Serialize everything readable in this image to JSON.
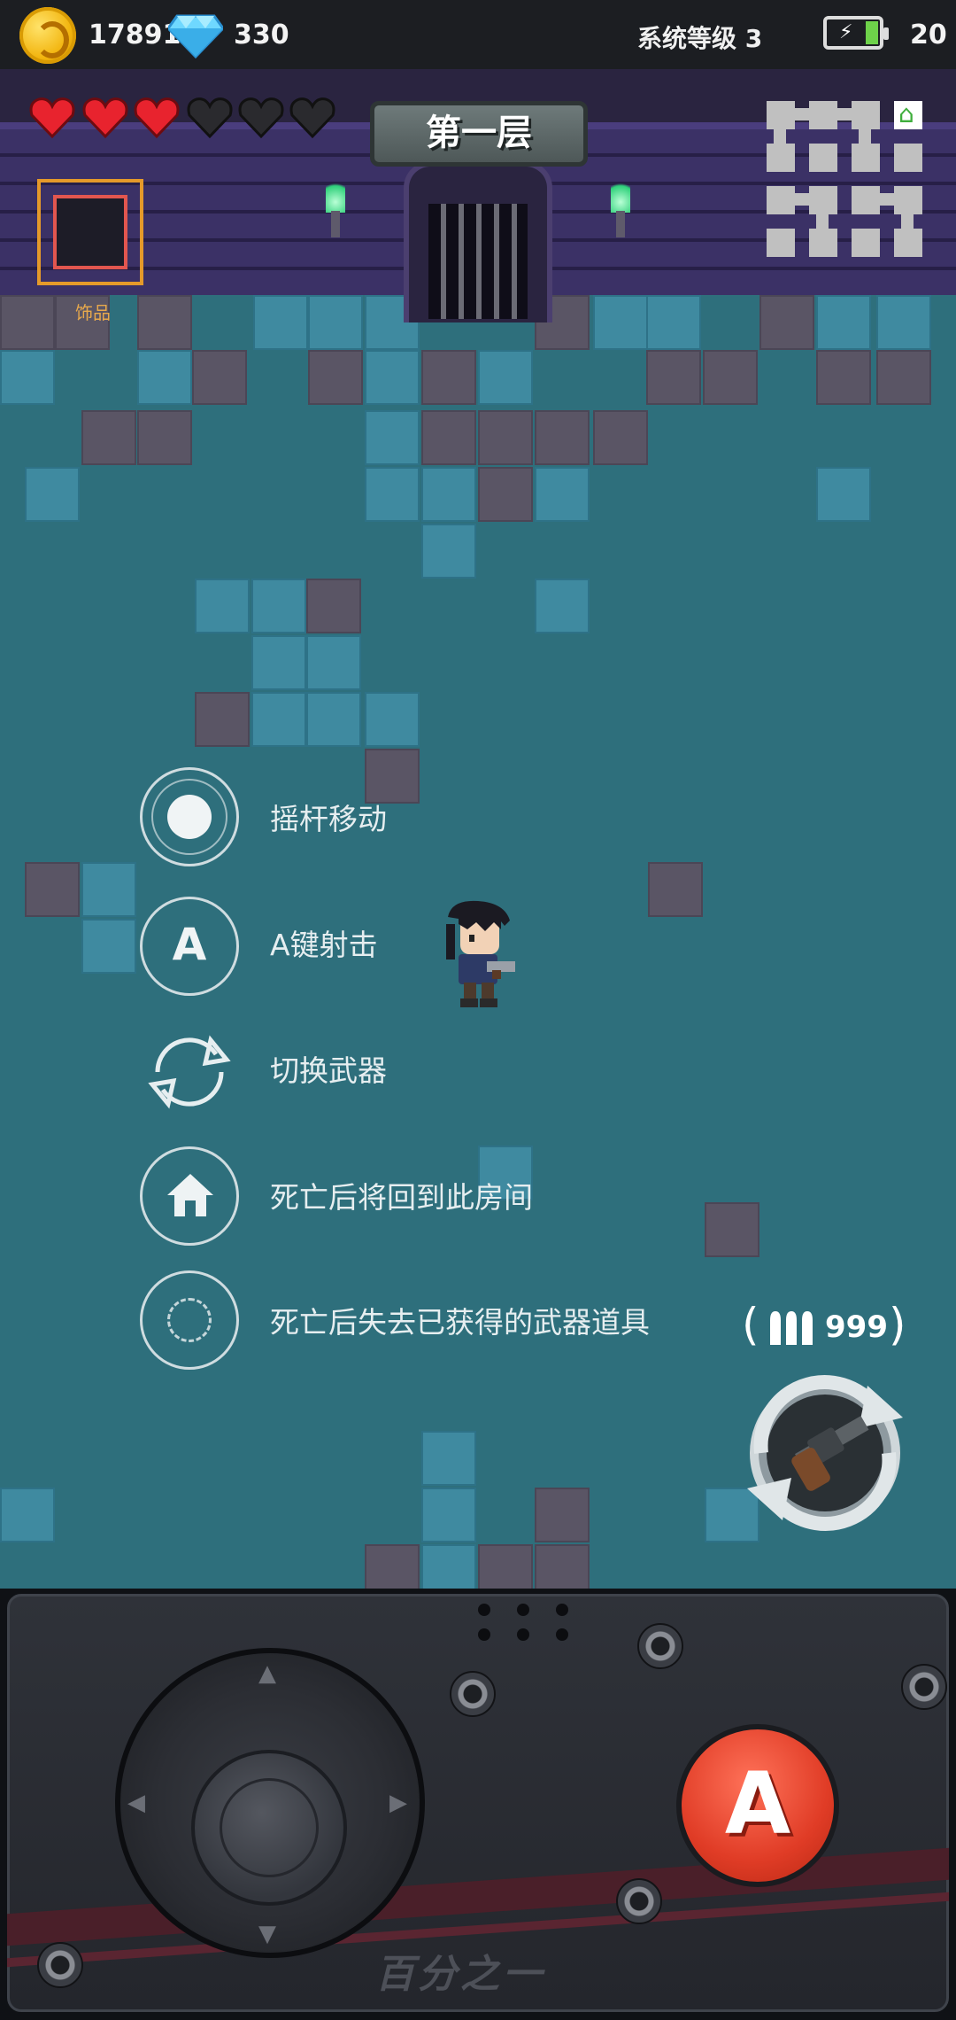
{
  "status_bar": {
    "coins": "17891",
    "gems": "330",
    "system_level": "系统等级 3",
    "energy": "20"
  },
  "hud": {
    "hearts_full": 3,
    "hearts_total": 6,
    "floor_title": "第一层",
    "accessory_label": "饰品"
  },
  "tutorial": {
    "items": [
      {
        "label": "摇杆移动",
        "icon": "joystick-icon"
      },
      {
        "label": "A键射击",
        "icon": "a-button-icon"
      },
      {
        "label": "切换武器",
        "icon": "switch-icon"
      },
      {
        "label": "死亡后将回到此房间",
        "icon": "home-icon"
      },
      {
        "label": "死亡后失去已获得的武器道具",
        "icon": "dashed-circle-icon"
      }
    ]
  },
  "weapon": {
    "ammo": "999",
    "name_icon": "revolver-icon"
  },
  "controls": {
    "a_button_label": "A",
    "brand": "百分之一"
  },
  "colors": {
    "floor": "#2e6f7c",
    "accent_red": "#e03c26",
    "heart_red": "#e8232e",
    "accessory_border": "#e59a2a"
  }
}
